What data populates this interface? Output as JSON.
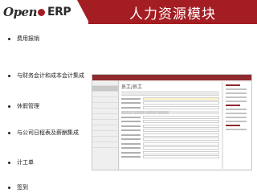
{
  "header": {
    "logo_open": "Open",
    "logo_erp": "ERP",
    "title": "人力资源模块",
    "accent_color": "#a31d22"
  },
  "bullets": [
    {
      "label": "费用报销"
    },
    {
      "label": "与财务会计和成本会计集成"
    },
    {
      "label": "休假管理"
    },
    {
      "label": "与公司日程表及薪酬集成"
    },
    {
      "label": "计工单"
    },
    {
      "label": "签到"
    }
  ],
  "screenshot": {
    "breadcrumb": "员工/员工"
  }
}
